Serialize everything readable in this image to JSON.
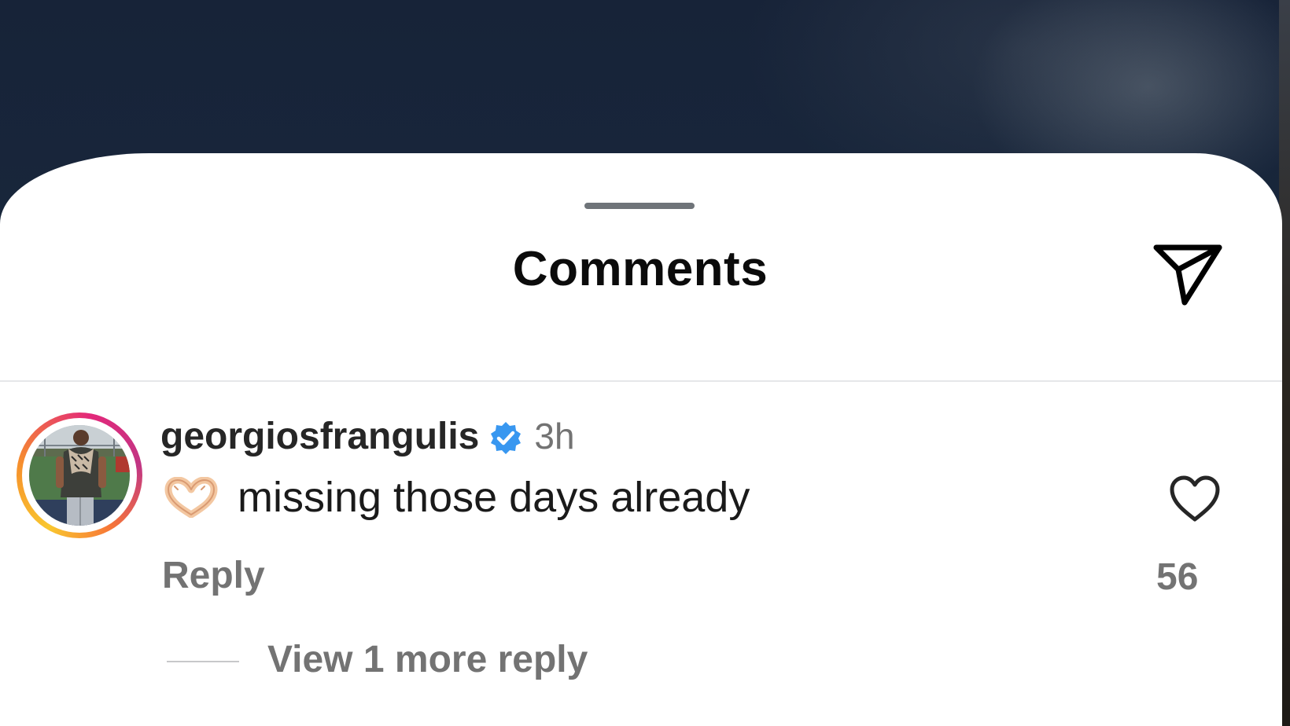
{
  "sheet": {
    "title": "Comments",
    "share_icon": "paper-plane-icon"
  },
  "comment": {
    "username": "georgiosfrangulis",
    "verified_icon": "verified-badge-icon",
    "timestamp": "3h",
    "emoji": "heart-hands-emoji",
    "text": "missing those days already",
    "like_icon": "heart-outline-icon",
    "like_count": "56",
    "reply_label": "Reply",
    "view_replies_label": "View 1 more reply"
  },
  "colors": {
    "backdrop": "#15243a",
    "sheet": "#ffffff",
    "verified": "#3897f0",
    "secondary_text": "#737373",
    "primary_text": "#262626"
  }
}
